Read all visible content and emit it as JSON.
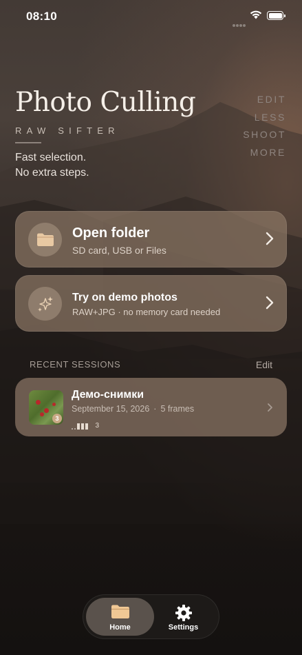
{
  "status_bar": {
    "time": "08:10"
  },
  "hero": {
    "title": "Photo Culling",
    "subtitle": "RAW SIFTER",
    "tagline": [
      "Fast selection.",
      "No extra steps."
    ],
    "motto": [
      "EDIT",
      "LESS",
      "SHOOT",
      "MORE"
    ]
  },
  "actions": [
    {
      "title": "Open folder",
      "subtitle": "SD card, USB or Files",
      "icon": "folder-icon"
    },
    {
      "title": "Try on demo photos",
      "subtitle": "RAW+JPG · no memory card needed",
      "icon": "sparkles-icon"
    }
  ],
  "recent": {
    "label": "RECENT SESSIONS",
    "edit_label": "Edit",
    "sessions": [
      {
        "title": "Демо-снимки",
        "date": "September 15, 2026",
        "frames": "5 frames",
        "badge": "3",
        "rating_count": "3"
      }
    ]
  },
  "tabbar": {
    "tabs": [
      {
        "label": "Home",
        "icon": "folder-icon",
        "selected": true
      },
      {
        "label": "Settings",
        "icon": "gear-icon",
        "selected": false
      }
    ]
  },
  "colors": {
    "card": "#8a7664",
    "folder_accent": "#e8c9a3",
    "background": "#171311"
  }
}
